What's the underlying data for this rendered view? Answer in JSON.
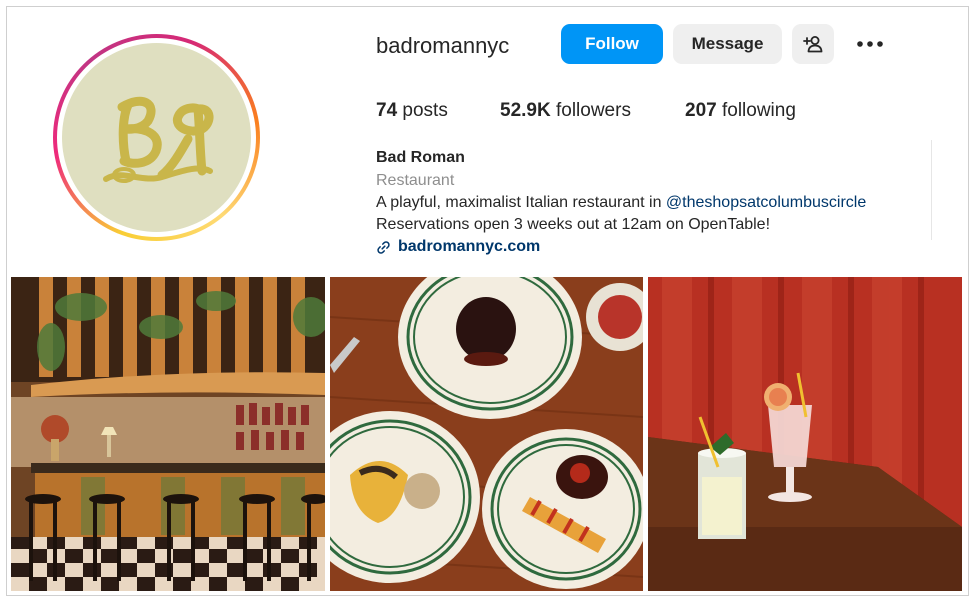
{
  "profile": {
    "username": "badromannyc",
    "avatar_text": "Bя",
    "follow_label": "Follow",
    "message_label": "Message",
    "add_user_icon": "add-user-icon",
    "more_icon": "more-icon"
  },
  "stats": {
    "posts_count": "74",
    "posts_label": "posts",
    "followers_count": "52.9K",
    "followers_label": "followers",
    "following_count": "207",
    "following_label": "following"
  },
  "bio": {
    "name": "Bad Roman",
    "category": "Restaurant",
    "line1_text": "A playful, maximalist Italian restaurant in ",
    "line1_mention": "@theshopsatcolumbuscircle",
    "line2": "Reservations open 3 weeks out at 12am on OpenTable!",
    "link": "badromannyc.com",
    "link_icon": "link-icon"
  },
  "colors": {
    "follow_button": "#0095f6",
    "secondary_button": "#efefef",
    "avatar_background": "#dfdfc0",
    "logo": "#c9b64a",
    "link": "#00376b"
  },
  "posts": [
    {
      "description_name": "post-bar-interior"
    },
    {
      "description_name": "post-plated-dishes"
    },
    {
      "description_name": "post-cocktails"
    }
  ]
}
